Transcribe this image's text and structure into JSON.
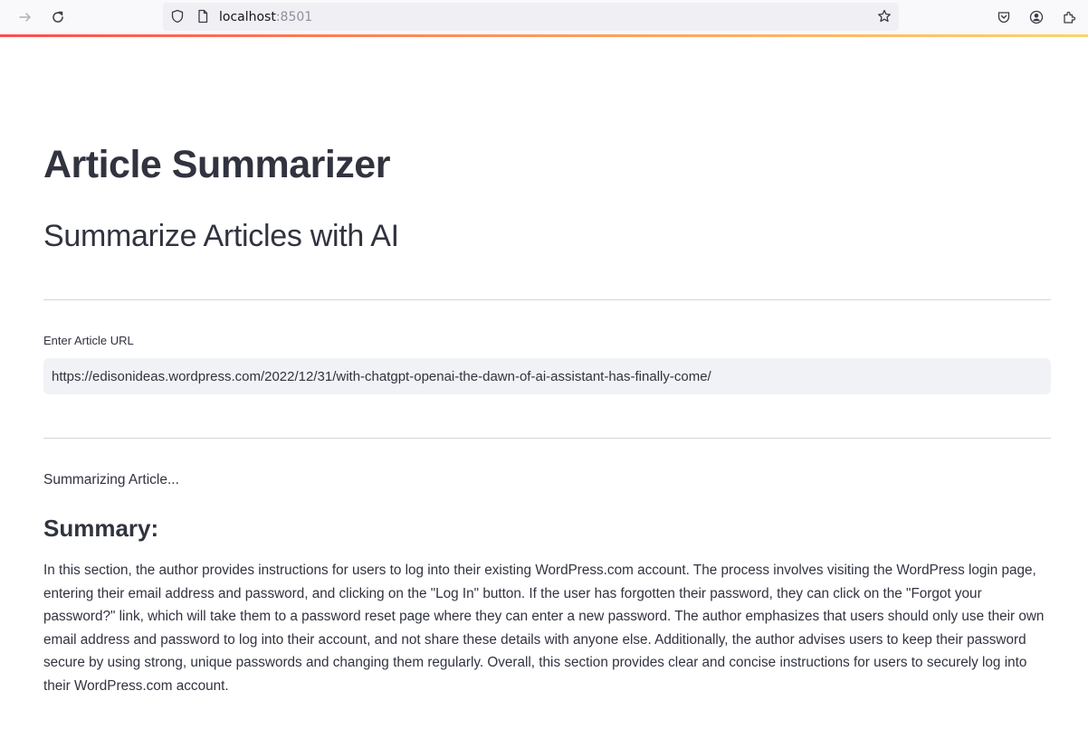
{
  "browser": {
    "url_host": "localhost",
    "url_port": ":8501",
    "icons": [
      "forward-icon",
      "reload-icon",
      "shield-icon",
      "page-icon",
      "bookmark-star-icon",
      "pocket-icon",
      "account-icon",
      "extensions-icon"
    ]
  },
  "app": {
    "title": "Article Summarizer",
    "subtitle": "Summarize Articles with AI",
    "input_label": "Enter Article URL",
    "input_value": "https://edisonideas.wordpress.com/2022/12/31/with-chatgpt-openai-the-dawn-of-ai-assistant-has-finally-come/",
    "status": "Summarizing Article...",
    "summary_heading": "Summary:",
    "summary_text": "In this section, the author provides instructions for users to log into their existing WordPress.com account. The process involves visiting the WordPress login page, entering their email address and password, and clicking on the \"Log In\" button. If the user has forgotten their password, they can click on the \"Forgot your password?\" link, which will take them to a password reset page where they can enter a new password. The author emphasizes that users should only use their own email address and password to log into their account, and not share these details with anyone else. Additionally, the author advises users to keep their password secure by using strong, unique passwords and changing them regularly. Overall, this section provides clear and concise instructions for users to securely log into their WordPress.com account."
  },
  "colors": {
    "text": "#31333f",
    "input_bg": "#f0f2f6",
    "accent_start": "#ff4b4b",
    "accent_end": "#fdd46b"
  }
}
